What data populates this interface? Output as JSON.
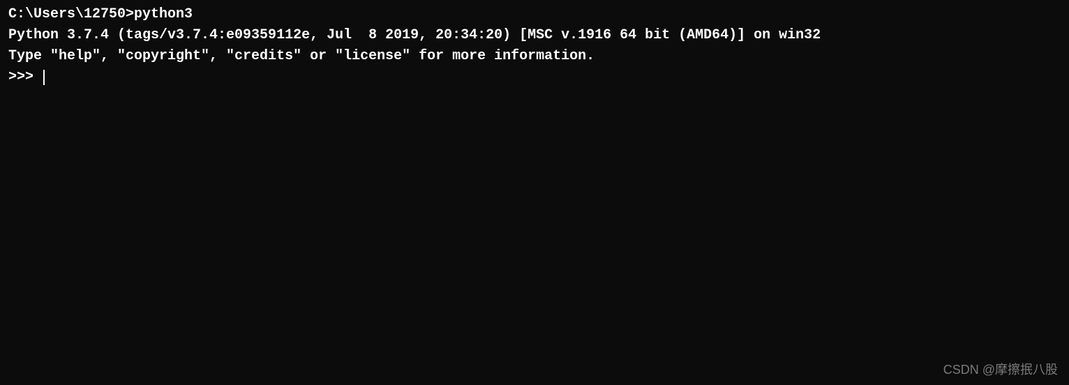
{
  "terminal": {
    "line1_prompt": "C:\\Users\\12750>",
    "line1_command": "python3",
    "line2": "Python 3.7.4 (tags/v3.7.4:e09359112e, Jul  8 2019, 20:34:20) [MSC v.1916 64 bit (AMD64)] on win32",
    "line3": "Type \"help\", \"copyright\", \"credits\" or \"license\" for more information.",
    "line4_prompt": ">>> "
  },
  "watermark": "CSDN @摩擦抿八股"
}
